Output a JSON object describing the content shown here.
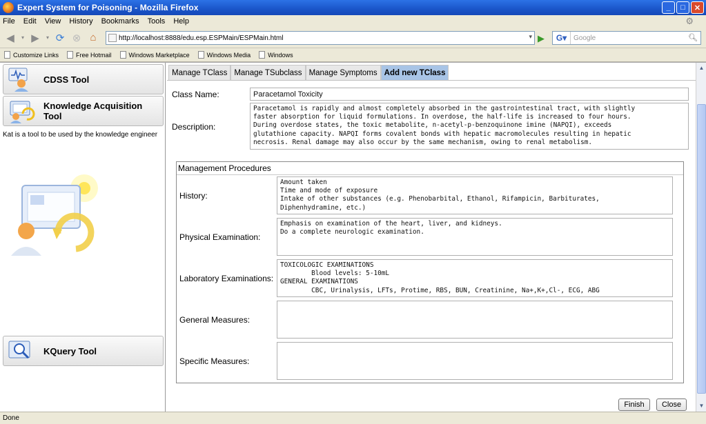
{
  "window": {
    "title": "Expert System for Poisoning - Mozilla Firefox"
  },
  "menu": [
    "File",
    "Edit",
    "View",
    "History",
    "Bookmarks",
    "Tools",
    "Help"
  ],
  "nav": {
    "url": "http://localhost:8888/edu.esp.ESPMain/ESPMain.html",
    "search_placeholder": "Google"
  },
  "bookmarks": [
    "Customize Links",
    "Free Hotmail",
    "Windows Marketplace",
    "Windows Media",
    "Windows"
  ],
  "left": {
    "cdss_label": "CDSS Tool",
    "kat_label": "Knowledge Acquisition Tool",
    "kat_description": "Kat is a tool to be used by the knowledge engineer",
    "kquery_label": "KQuery Tool"
  },
  "tabs": [
    "Manage TClass",
    "Manage TSubclass",
    "Manage Symptoms",
    "Add new TClass"
  ],
  "active_tab": 3,
  "form": {
    "class_name_label": "Class Name:",
    "class_name_value": "Paracetamol Toxicity",
    "description_label": "Description:",
    "description_value": "Paracetamol is rapidly and almost completely absorbed in the gastrointestinal tract, with slightly\nfaster absorption for liquid formulations. In overdose, the half-life is increased to four hours.\nDuring overdose states, the toxic metabolite, n-acetyl-p-benzoquinone imine (NAPQI), exceeds\nglutathione capacity. NAPQI forms covalent bonds with hepatic macromolecules resulting in hepatic\nnecrosis. Renal damage may also occur by the same mechanism, owing to renal metabolism.",
    "management_title": "Management Procedures",
    "history_label": "History:",
    "history_value": "Amount taken\nTime and mode of exposure\nIntake of other substances (e.g. Phenobarbital, Ethanol, Rifampicin, Barbiturates,\nDiphenhydramine, etc.)",
    "physical_label": "Physical Examination:",
    "physical_value": "Emphasis on examination of the heart, liver, and kidneys.\nDo a complete neurologic examination.",
    "lab_label": "Laboratory Examinations:",
    "lab_value": "TOXICOLOGIC EXAMINATIONS\n        Blood levels: 5-10mL\nGENERAL EXAMINATIONS\n        CBC, Urinalysis, LFTs, Protime, RBS, BUN, Creatinine, Na+,K+,Cl-, ECG, ABG",
    "general_label": "General Measures:",
    "general_value": "",
    "specific_label": "Specific Measures:",
    "specific_value": ""
  },
  "buttons": {
    "finish": "Finish",
    "close": "Close"
  },
  "status": "Done",
  "colors": {
    "titlebar": "#1a55c9",
    "active_tab": "#a8c4e6"
  }
}
